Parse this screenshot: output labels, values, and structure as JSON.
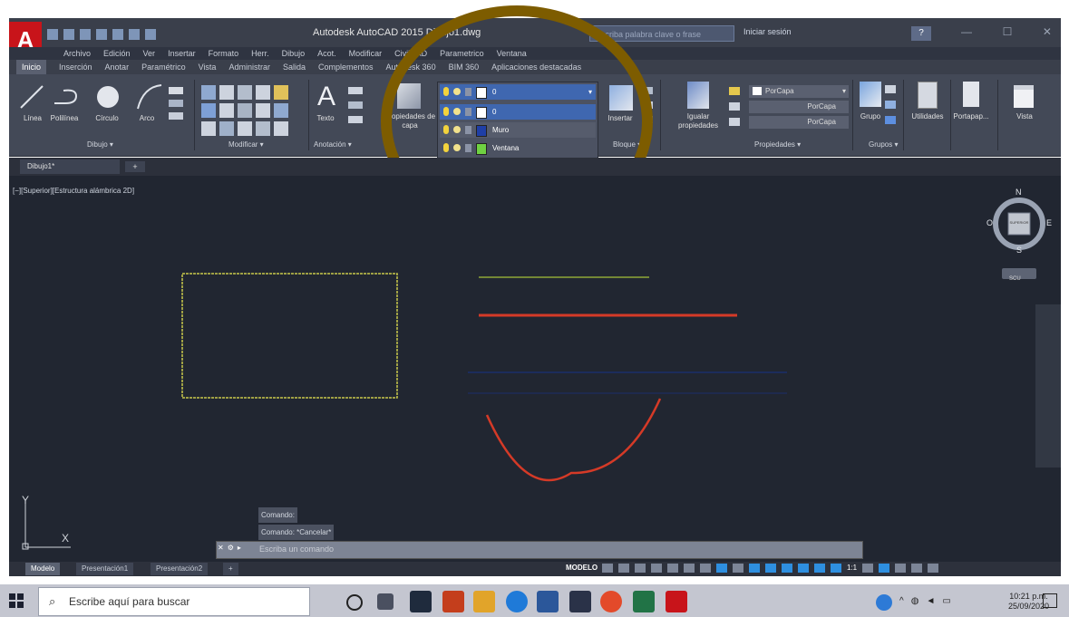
{
  "window": {
    "title": "Autodesk AutoCAD 2015   Dibujo1.dwg",
    "search_placeholder": "Escriba palabra clave o frase",
    "signin": "Iniciar sesión",
    "help": "?"
  },
  "menubar": [
    "Archivo",
    "Edición",
    "Ver",
    "Insertar",
    "Formato",
    "Herr.",
    "Dibujo",
    "Acot.",
    "Modificar",
    "CivilCAD",
    "Parametrico",
    "Ventana"
  ],
  "ribbon_tabs": [
    "Inicio",
    "Inserción",
    "Anotar",
    "Paramétrico",
    "Vista",
    "Administrar",
    "Salida",
    "Complementos",
    "Autodesk 360",
    "BIM 360",
    "Aplicaciones destacadas"
  ],
  "ribbon": {
    "draw": {
      "line": "Línea",
      "polyline": "Polilínea",
      "circle": "Círculo",
      "arc": "Arco",
      "panel": "Dibujo ▾"
    },
    "modify": {
      "panel": "Modificar ▾"
    },
    "annotation": {
      "text": "Texto",
      "panel": "Anotación ▾"
    },
    "layers": {
      "properties": "Propiedades de capa"
    },
    "block": {
      "insert": "Insertar",
      "panel": "Bloque ▾"
    },
    "properties": {
      "match": "Igualar propiedades",
      "color": "PorCapa",
      "linetype": "PorCapa",
      "lineweight": "PorCapa",
      "panel": "Propiedades ▾"
    },
    "groups": {
      "group": "Grupo",
      "panel": "Grupos ▾"
    },
    "utilities": "Utilidades",
    "clipboard": "Portapap...",
    "view": "Vista"
  },
  "layer_dropdown": {
    "current": "0",
    "rows": [
      {
        "name": "0",
        "color": "#ffffff"
      },
      {
        "name": "Muro",
        "color": "#1f3fa6"
      },
      {
        "name": "Ventana",
        "color": "#6fd142"
      },
      {
        "name": "",
        "color": "#d3261c"
      }
    ]
  },
  "doc_tabs": {
    "active": "Dibujo1*",
    "new": "+"
  },
  "viewport": {
    "label": "[−][Superior][Estructura alámbrica 2D]",
    "viewcube": {
      "north": "N",
      "south": "S",
      "east": "E",
      "west": "O",
      "face": "SUPERIOR",
      "wcs": "SCU"
    }
  },
  "command": {
    "history": [
      "Comando:",
      "Comando: *Cancelar*"
    ],
    "placeholder": "Escriba un comando"
  },
  "layout_tabs": [
    "Modelo",
    "Presentación1",
    "Presentación2",
    "+"
  ],
  "status": {
    "model": "MODELO",
    "scale": "1:1"
  },
  "taskbar": {
    "search": "Escribe aquí para buscar",
    "time": "10:21 p.m.",
    "date": "25/09/2020"
  },
  "colors": {
    "canvas": "#212631",
    "ribbon": "#434957",
    "highlight_circle": "#7d5c00",
    "yellow": "#c9c84b",
    "red": "#d53a27",
    "blue": "#1f3fa6"
  }
}
